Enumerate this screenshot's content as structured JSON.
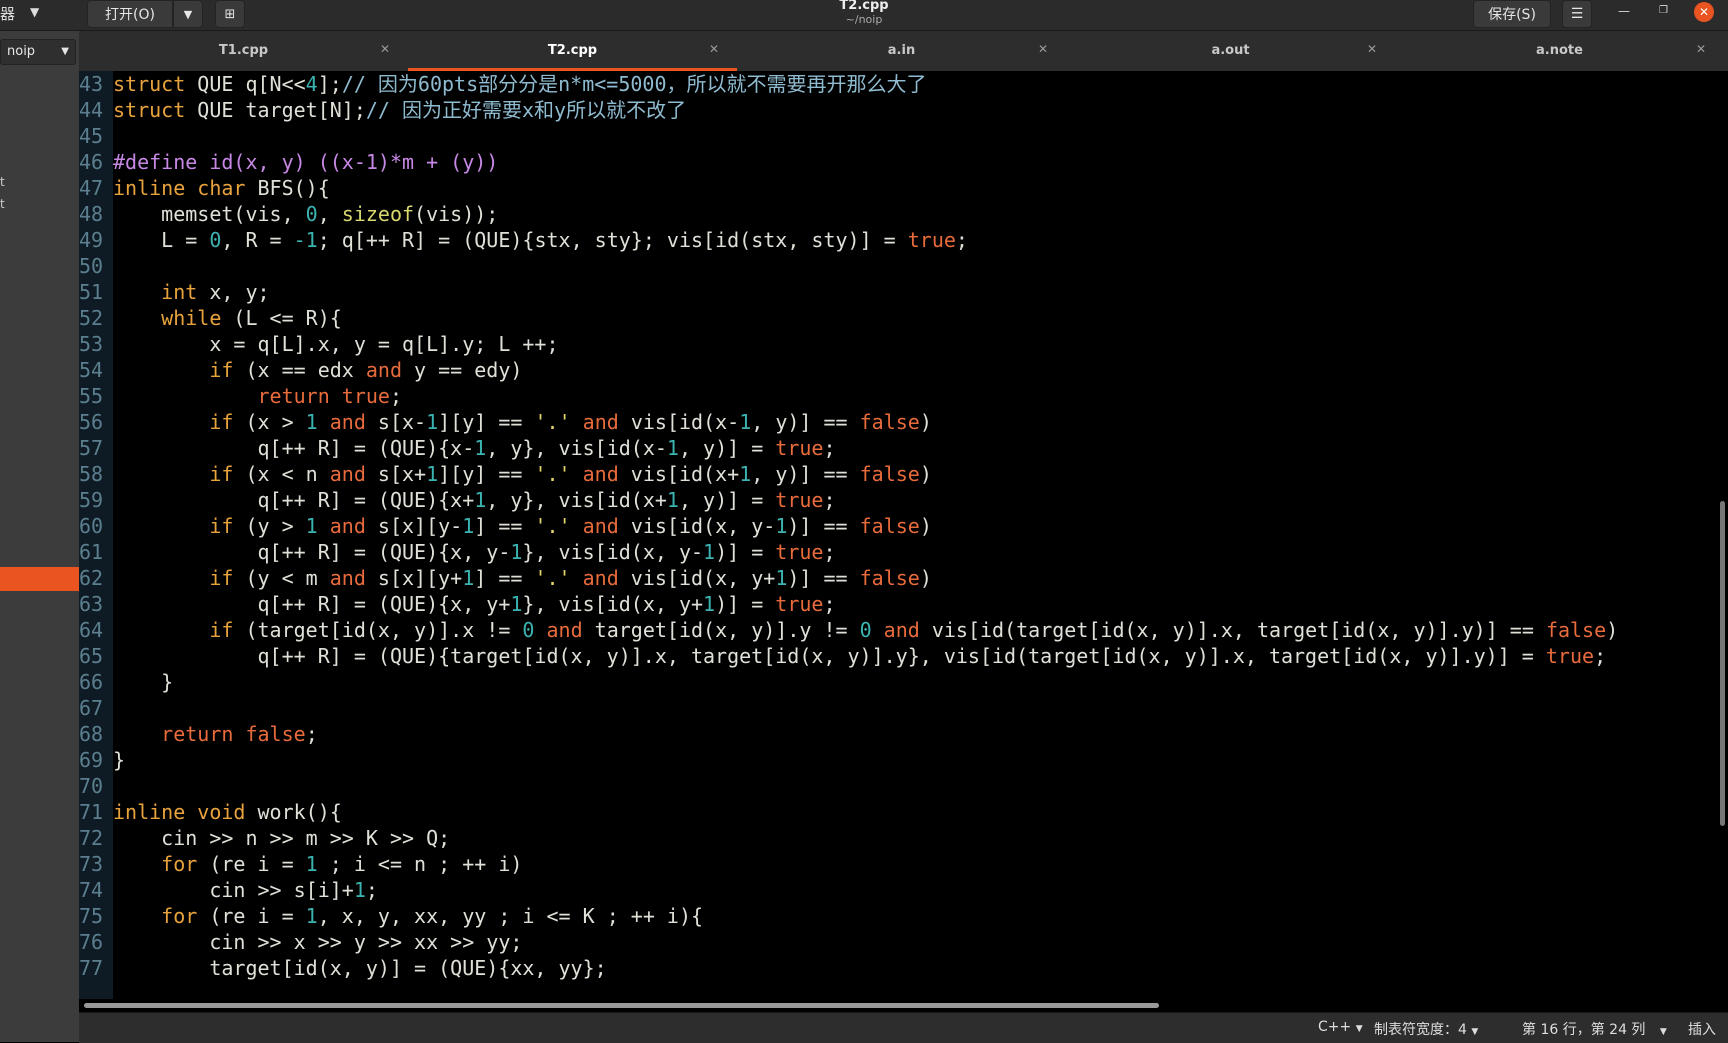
{
  "header": {
    "left_fragment": "器",
    "open_label": "打开(O)",
    "title": "T2.cpp",
    "subtitle": "~/noip",
    "save_label": "保存(S)"
  },
  "sidebar": {
    "select_value": "noip",
    "fragments": [
      "t",
      "t"
    ]
  },
  "tabs": [
    {
      "label": "T1.cpp",
      "active": false
    },
    {
      "label": "T2.cpp",
      "active": true
    },
    {
      "label": "a.in",
      "active": false
    },
    {
      "label": "a.out",
      "active": false
    },
    {
      "label": "a.note",
      "active": false
    }
  ],
  "colors": {
    "accent": "#e95420",
    "keyword": "#e8a33d",
    "constant": "#e86b3c",
    "number": "#3bb3b0",
    "string": "#e4d66b",
    "comment": "#8fbbd0",
    "preprocessor": "#c889e6"
  },
  "code": [
    {
      "n": "43",
      "html": "<span class=\"k\">struct</span> QUE q[N&lt;&lt;<span class=\"n\">4</span>];<span class=\"c\">// 因为60pts部分分是n*m&lt;=5000，所以就不需要再开那么大了</span>"
    },
    {
      "n": "44",
      "html": "<span class=\"k\">struct</span> QUE target[N];<span class=\"c\">// 因为正好需要x和y所以就不改了</span>"
    },
    {
      "n": "45",
      "html": ""
    },
    {
      "n": "46",
      "html": "<span class=\"p\">#define id(x, y) ((x-1)*m + (y))</span>"
    },
    {
      "n": "47",
      "html": "<span class=\"k\">inline</span> <span class=\"k\">char</span> BFS(){"
    },
    {
      "n": "48",
      "html": "    memset(vis, <span class=\"n\">0</span>, <span class=\"f\">sizeof</span>(vis));"
    },
    {
      "n": "49",
      "html": "    L = <span class=\"n\">0</span>, R = <span class=\"n\">-1</span>; q[++ R] = (QUE){stx, sty}; vis[id(stx, sty)] = <span class=\"r\">true</span>;"
    },
    {
      "n": "50",
      "html": ""
    },
    {
      "n": "51",
      "html": "    <span class=\"k\">int</span> x, y;"
    },
    {
      "n": "52",
      "html": "    <span class=\"k\">while</span> (L &lt;= R){"
    },
    {
      "n": "53",
      "html": "        x = q[L].x, y = q[L].y; L ++;"
    },
    {
      "n": "54",
      "html": "        <span class=\"k\">if</span> (x == edx <span class=\"r\">and</span> y == edy)"
    },
    {
      "n": "55",
      "html": "            <span class=\"r\">return</span> <span class=\"r\">true</span>;"
    },
    {
      "n": "56",
      "html": "        <span class=\"k\">if</span> (x &gt; <span class=\"n\">1</span> <span class=\"r\">and</span> s[x-<span class=\"n\">1</span>][y] == <span class=\"s\">'.'</span> <span class=\"r\">and</span> vis[id(x-<span class=\"n\">1</span>, y)] == <span class=\"r\">false</span>)"
    },
    {
      "n": "57",
      "html": "            q[++ R] = (QUE){x-<span class=\"n\">1</span>, y}, vis[id(x-<span class=\"n\">1</span>, y)] = <span class=\"r\">true</span>;"
    },
    {
      "n": "58",
      "html": "        <span class=\"k\">if</span> (x &lt; n <span class=\"r\">and</span> s[x+<span class=\"n\">1</span>][y] == <span class=\"s\">'.'</span> <span class=\"r\">and</span> vis[id(x+<span class=\"n\">1</span>, y)] == <span class=\"r\">false</span>)"
    },
    {
      "n": "59",
      "html": "            q[++ R] = (QUE){x+<span class=\"n\">1</span>, y}, vis[id(x+<span class=\"n\">1</span>, y)] = <span class=\"r\">true</span>;"
    },
    {
      "n": "60",
      "html": "        <span class=\"k\">if</span> (y &gt; <span class=\"n\">1</span> <span class=\"r\">and</span> s[x][y-<span class=\"n\">1</span>] == <span class=\"s\">'.'</span> <span class=\"r\">and</span> vis[id(x, y-<span class=\"n\">1</span>)] == <span class=\"r\">false</span>)"
    },
    {
      "n": "61",
      "html": "            q[++ R] = (QUE){x, y-<span class=\"n\">1</span>}, vis[id(x, y-<span class=\"n\">1</span>)] = <span class=\"r\">true</span>;"
    },
    {
      "n": "62",
      "html": "        <span class=\"k\">if</span> (y &lt; m <span class=\"r\">and</span> s[x][y+<span class=\"n\">1</span>] == <span class=\"s\">'.'</span> <span class=\"r\">and</span> vis[id(x, y+<span class=\"n\">1</span>)] == <span class=\"r\">false</span>)"
    },
    {
      "n": "63",
      "html": "            q[++ R] = (QUE){x, y+<span class=\"n\">1</span>}, vis[id(x, y+<span class=\"n\">1</span>)] = <span class=\"r\">true</span>;"
    },
    {
      "n": "64",
      "html": "        <span class=\"k\">if</span> (target[id(x, y)].x != <span class=\"n\">0</span> <span class=\"r\">and</span> target[id(x, y)].y != <span class=\"n\">0</span> <span class=\"r\">and</span> vis[id(target[id(x, y)].x, target[id(x, y)].y)] == <span class=\"r\">false</span>)"
    },
    {
      "n": "65",
      "html": "            q[++ R] = (QUE){target[id(x, y)].x, target[id(x, y)].y}, vis[id(target[id(x, y)].x, target[id(x, y)].y)] = <span class=\"r\">true</span>;"
    },
    {
      "n": "66",
      "html": "    }"
    },
    {
      "n": "67",
      "html": ""
    },
    {
      "n": "68",
      "html": "    <span class=\"r\">return</span> <span class=\"r\">false</span>;"
    },
    {
      "n": "69",
      "html": "}"
    },
    {
      "n": "70",
      "html": ""
    },
    {
      "n": "71",
      "html": "<span class=\"k\">inline</span> <span class=\"k\">void</span> work(){"
    },
    {
      "n": "72",
      "html": "    cin &gt;&gt; n &gt;&gt; m &gt;&gt; K &gt;&gt; Q;"
    },
    {
      "n": "73",
      "html": "    <span class=\"k\">for</span> (re i = <span class=\"n\">1</span> ; i &lt;= n ; ++ i)"
    },
    {
      "n": "74",
      "html": "        cin &gt;&gt; s[i]+<span class=\"n\">1</span>;"
    },
    {
      "n": "75",
      "html": "    <span class=\"k\">for</span> (re i = <span class=\"n\">1</span>, x, y, xx, yy ; i &lt;= K ; ++ i){"
    },
    {
      "n": "76",
      "html": "        cin &gt;&gt; x &gt;&gt; y &gt;&gt; xx &gt;&gt; yy;"
    },
    {
      "n": "77",
      "html": "        target[id(x, y)] = (QUE){xx, yy};"
    }
  ],
  "status": {
    "language": "C++",
    "tab_width_label": "制表符宽度：4",
    "position": "第 16 行，第 24 列",
    "mode": "插入"
  }
}
